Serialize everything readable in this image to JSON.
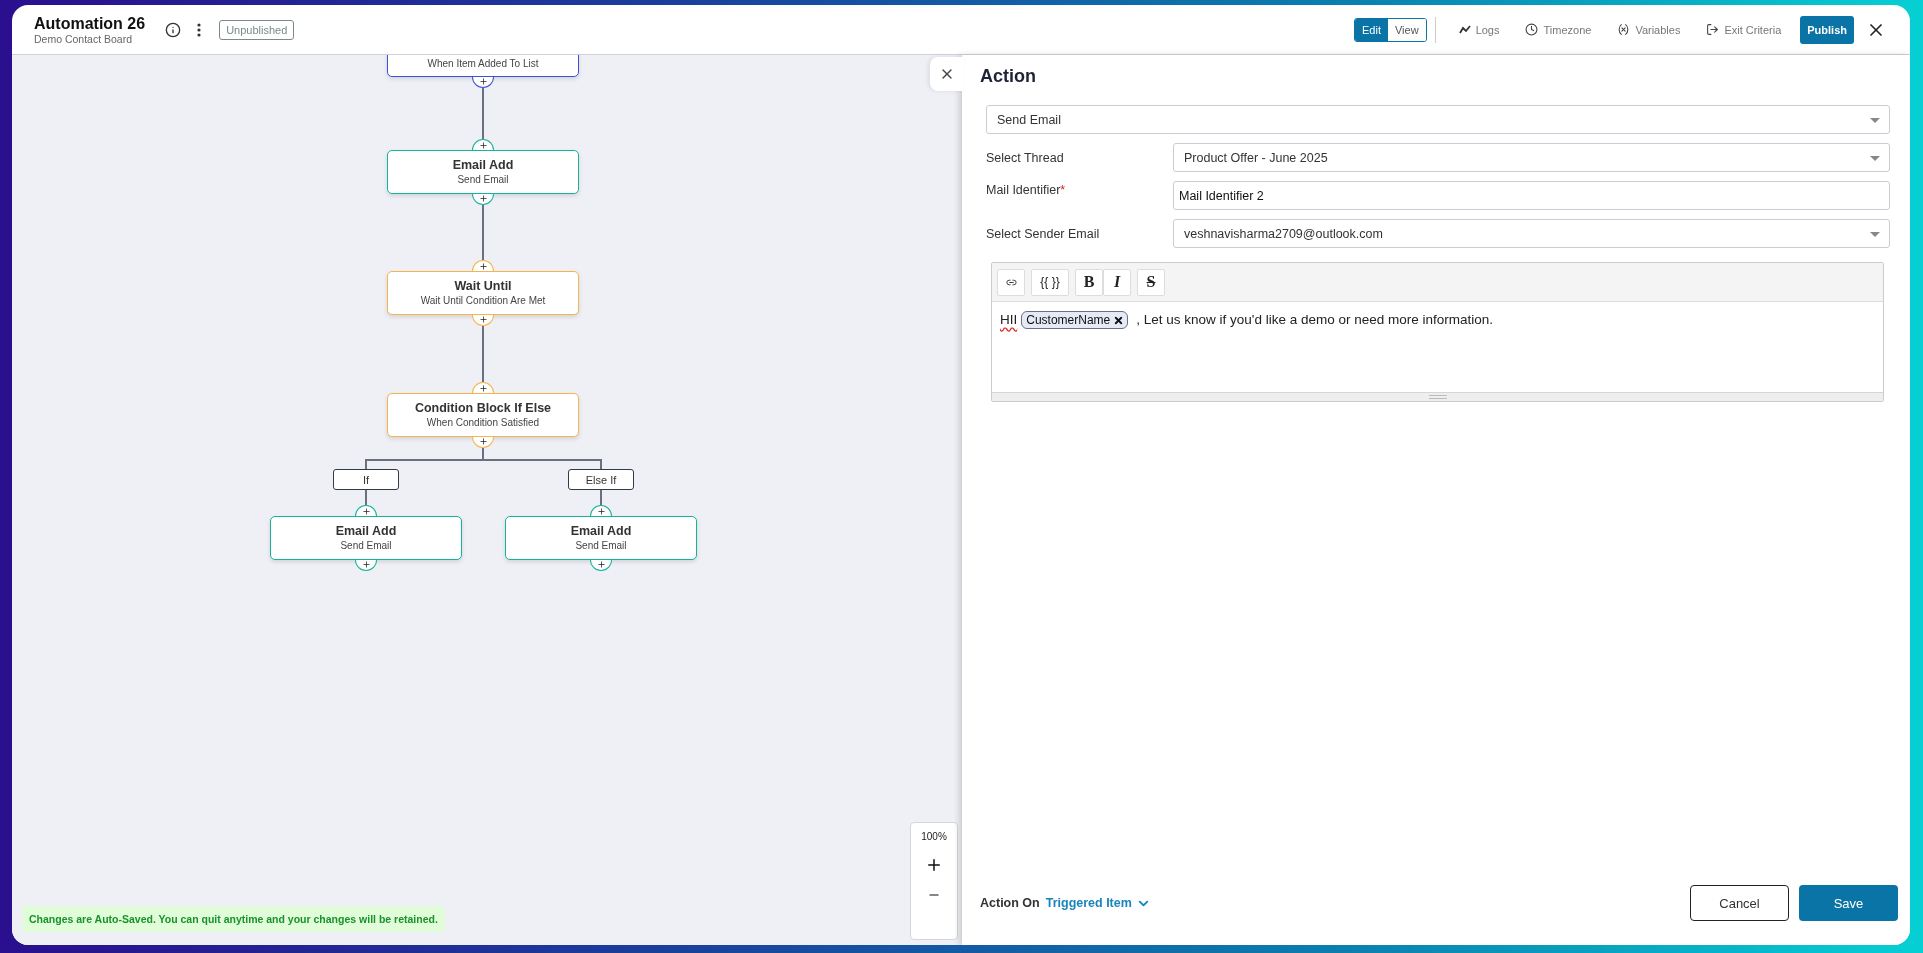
{
  "header": {
    "title": "Automation 26",
    "subtitle": "Demo Contact Board",
    "status": "Unpublished"
  },
  "mode_toggle": [
    {
      "label": "Edit",
      "selected": true
    },
    {
      "label": "View",
      "selected": false
    }
  ],
  "tools": [
    {
      "kind": "logs",
      "label": "Logs"
    },
    {
      "kind": "timezone",
      "label": "Timezone"
    },
    {
      "kind": "variables",
      "label": "Variables"
    },
    {
      "kind": "exit",
      "label": "Exit Criteria"
    }
  ],
  "publish_button": "Publish",
  "flow": {
    "nodes": [
      {
        "kind": "trigger",
        "subtitle": "When Item Added To List"
      },
      {
        "kind": "action",
        "title": "Email Add",
        "subtitle": "Send Email"
      },
      {
        "kind": "wait",
        "title": "Wait Until",
        "subtitle": "Wait Until Condition Are Met"
      },
      {
        "kind": "condition",
        "title": "Condition Block If Else",
        "subtitle": "When Condition Satisfied"
      },
      {
        "kind": "action",
        "title": "Email Add",
        "subtitle": "Send Email"
      },
      {
        "kind": "action",
        "title": "Email Add",
        "subtitle": "Send Email"
      }
    ],
    "branches": [
      "If",
      "Else If"
    ]
  },
  "zoom_label": "100%",
  "notice": "Changes are Auto-Saved. You can quit anytime and your changes will be retained.",
  "panel": {
    "title": "Action",
    "action_type": "Send Email",
    "fields": [
      {
        "kind": "select",
        "label": "Select Thread",
        "value": "Product Offer - June 2025"
      },
      {
        "kind": "text",
        "label": "Mail Identifier",
        "required_mark": "*",
        "value": "Mail Identifier 2"
      },
      {
        "kind": "select",
        "label": "Select Sender Email",
        "value": "veshnavisharma2709@outlook.com"
      }
    ],
    "editor": {
      "toolbar": [
        {
          "kind": "link"
        },
        {
          "kind": "variable",
          "label": "{{ }}"
        },
        {
          "kind": "bold",
          "label": "B"
        },
        {
          "kind": "italic",
          "label": "I"
        },
        {
          "kind": "strike",
          "label": "S"
        }
      ],
      "content": [
        {
          "kind": "text",
          "text": "HII",
          "misspelled": true
        },
        {
          "kind": "tag",
          "text": "CustomerName"
        },
        {
          "kind": "text",
          "text": ", Let us know if you'd like a demo or need more information.",
          "misspelled": false
        }
      ]
    },
    "action_on": {
      "label": "Action On",
      "value": "Triggered Item"
    },
    "buttons": [
      {
        "kind": "secondary",
        "label": "Cancel"
      },
      {
        "kind": "primary",
        "label": "Save"
      }
    ]
  }
}
